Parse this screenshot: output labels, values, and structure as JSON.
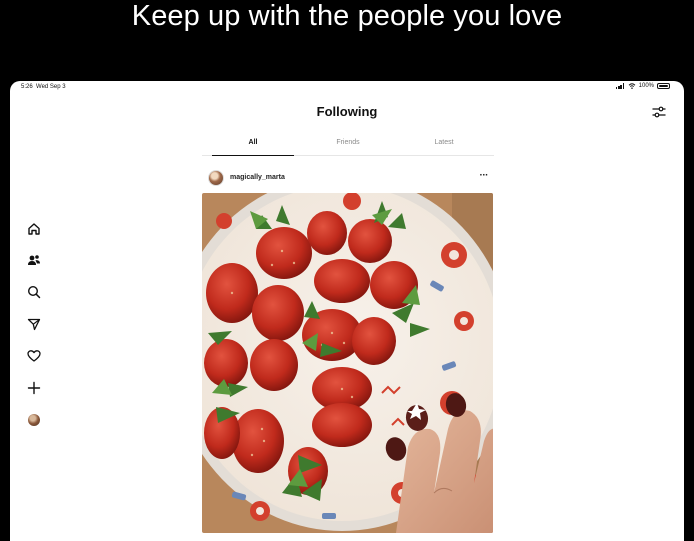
{
  "headline": "Keep up with the people you love",
  "status_bar": {
    "time": "5:26",
    "date": "Wed Sep 3",
    "battery": "100%"
  },
  "feed": {
    "title": "Following",
    "tabs": [
      {
        "label": "All",
        "active": true
      },
      {
        "label": "Friends",
        "active": false
      },
      {
        "label": "Latest",
        "active": false
      }
    ]
  },
  "nav_icons": [
    "home-icon",
    "people-icon",
    "search-icon",
    "send-icon",
    "heart-icon",
    "plus-icon",
    "profile-avatar"
  ],
  "post": {
    "username": "magically_marta",
    "more_label": "···",
    "media": "photo of strawberries on a decorative plate with a painted hand"
  },
  "colors": {
    "background": "#000000",
    "panel": "#ffffff",
    "text": "#111111",
    "muted": "#8a8a8a"
  }
}
